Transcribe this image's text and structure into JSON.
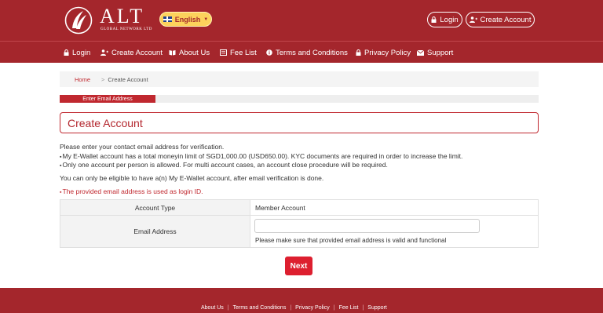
{
  "header": {
    "logo_text": "ALT",
    "logo_subtext": "GLOBAL NETWORK LTD",
    "language": "English",
    "login_label": "Login",
    "create_account_label": "Create Account"
  },
  "nav": {
    "items": [
      {
        "label": "Login",
        "icon": "lock-icon"
      },
      {
        "label": "Create Account",
        "icon": "user-plus-icon"
      },
      {
        "label": "About Us",
        "icon": "book-icon"
      },
      {
        "label": "Fee List",
        "icon": "list-icon"
      },
      {
        "label": "Terms and Conditions",
        "icon": "info-icon"
      },
      {
        "label": "Privacy Policy",
        "icon": "lock-icon"
      },
      {
        "label": "Support",
        "icon": "envelope-icon"
      }
    ]
  },
  "breadcrumb": {
    "home": "Home",
    "separator": ">",
    "current": "Create Account"
  },
  "steps": {
    "active": "Enter Email Address"
  },
  "page_title": "Create Account",
  "intro": {
    "line1": "Please enter your contact email address for verification.",
    "line2": "My E-Wallet account has a total moneyin limit of SGD1,000.00 (USD650.00). KYC documents are required in order to increase the limit.",
    "line3": "Only one account per person is allowed. For multi account cases, an account close procedure will be required.",
    "line4": "You can only be eligible to have a(n) My E-Wallet account, after email verification is done.",
    "line5": "The provided email address is used as login ID."
  },
  "form": {
    "account_type_label": "Account Type",
    "account_type_value": "Member Account",
    "email_label": "Email Address",
    "email_value": "",
    "email_hint": "Please make sure that provided email address is valid and functional",
    "next_label": "Next"
  },
  "footer": {
    "links": [
      "About Us",
      "Terms and Conditions",
      "Privacy Policy",
      "Fee List",
      "Support"
    ]
  },
  "colors": {
    "brand": "#a4262c",
    "accent": "#dd1f2f",
    "language_button": "#fcd25c"
  }
}
